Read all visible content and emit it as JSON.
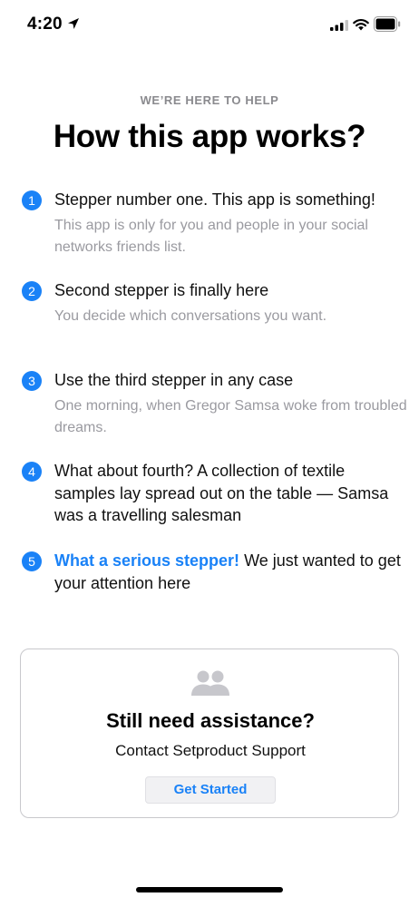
{
  "status_bar": {
    "time": "4:20",
    "icons": [
      "location-arrow-icon",
      "cellular-signal-icon",
      "wifi-icon",
      "battery-icon"
    ]
  },
  "header": {
    "eyebrow": "WE’RE HERE TO HELP",
    "title": "How this app works?"
  },
  "steps": [
    {
      "number": "1",
      "title": "Stepper number one. This app is something!",
      "description": "This app is only for you and people in your social networks friends list."
    },
    {
      "number": "2",
      "title": "Second stepper is finally here",
      "description": "You decide which conversations you want."
    },
    {
      "number": "3",
      "title": "Use the third stepper in any case",
      "description": "One morning, when Gregor Samsa woke from troubled dreams."
    },
    {
      "number": "4",
      "title": "What about fourth? A collection of textile samples lay spread out on the table — Samsa was a travelling salesman",
      "description": ""
    },
    {
      "number": "5",
      "title_highlight": "What a serious stepper!",
      "title": "We just wanted to get your attention here",
      "description": ""
    }
  ],
  "support_card": {
    "icon": "people-icon",
    "title": "Still need assistance?",
    "subtitle": "Contact Setproduct Support",
    "button_label": "Get Started"
  },
  "colors": {
    "accent": "#1a82f7",
    "secondary_text": "#9a9aa0",
    "card_border": "#c8c8cc"
  }
}
